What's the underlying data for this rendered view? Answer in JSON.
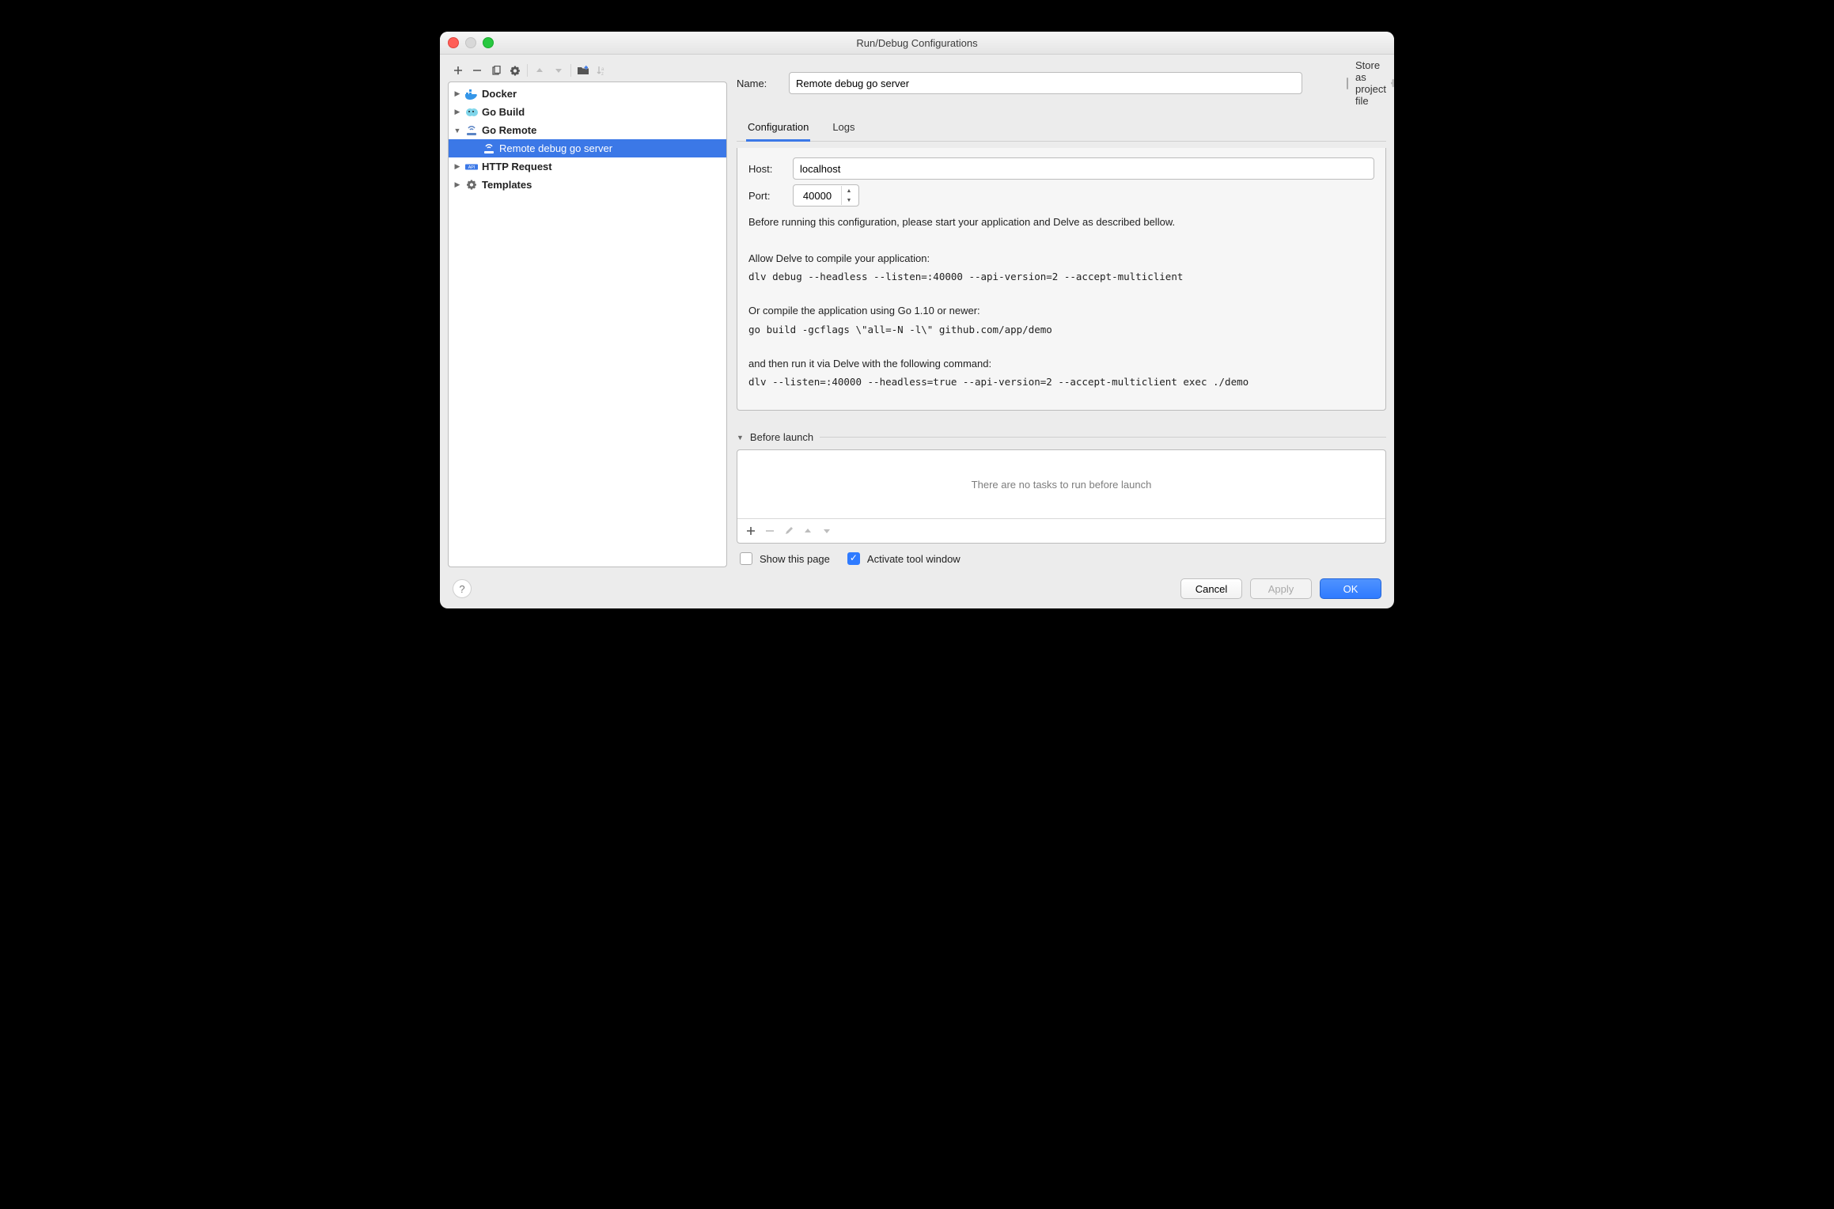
{
  "window": {
    "title": "Run/Debug Configurations"
  },
  "sidebar": {
    "items": [
      {
        "label": "Docker",
        "expanded": false
      },
      {
        "label": "Go Build",
        "expanded": false
      },
      {
        "label": "Go Remote",
        "expanded": true,
        "children": [
          {
            "label": "Remote debug go server",
            "selected": true
          }
        ]
      },
      {
        "label": "HTTP Request",
        "expanded": false
      },
      {
        "label": "Templates",
        "expanded": false
      }
    ]
  },
  "name": {
    "label": "Name:",
    "value": "Remote debug go server"
  },
  "store": {
    "label": "Store as project file",
    "checked": false
  },
  "tabs": {
    "configuration": "Configuration",
    "logs": "Logs",
    "active": "configuration"
  },
  "config": {
    "host_label": "Host:",
    "host_value": "localhost",
    "port_label": "Port:",
    "port_value": "40000",
    "line1": "Before running this configuration, please start your application and Delve as described bellow.",
    "line2": "Allow Delve to compile your application:",
    "cmd1": "dlv debug --headless --listen=:40000 --api-version=2 --accept-multiclient",
    "line3": "Or compile the application using Go 1.10 or newer:",
    "cmd2": "go build -gcflags \\\"all=-N -l\\\" github.com/app/demo",
    "line4": "and then run it via Delve with the following command:",
    "cmd3": "dlv --listen=:40000 --headless=true --api-version=2 --accept-multiclient exec ./demo"
  },
  "before_launch": {
    "title": "Before launch",
    "empty_text": "There are no tasks to run before launch",
    "show_this_page": {
      "label": "Show this page",
      "checked": false
    },
    "activate_tool": {
      "label": "Activate tool window",
      "checked": true
    }
  },
  "footer": {
    "cancel": "Cancel",
    "apply": "Apply",
    "ok": "OK"
  }
}
